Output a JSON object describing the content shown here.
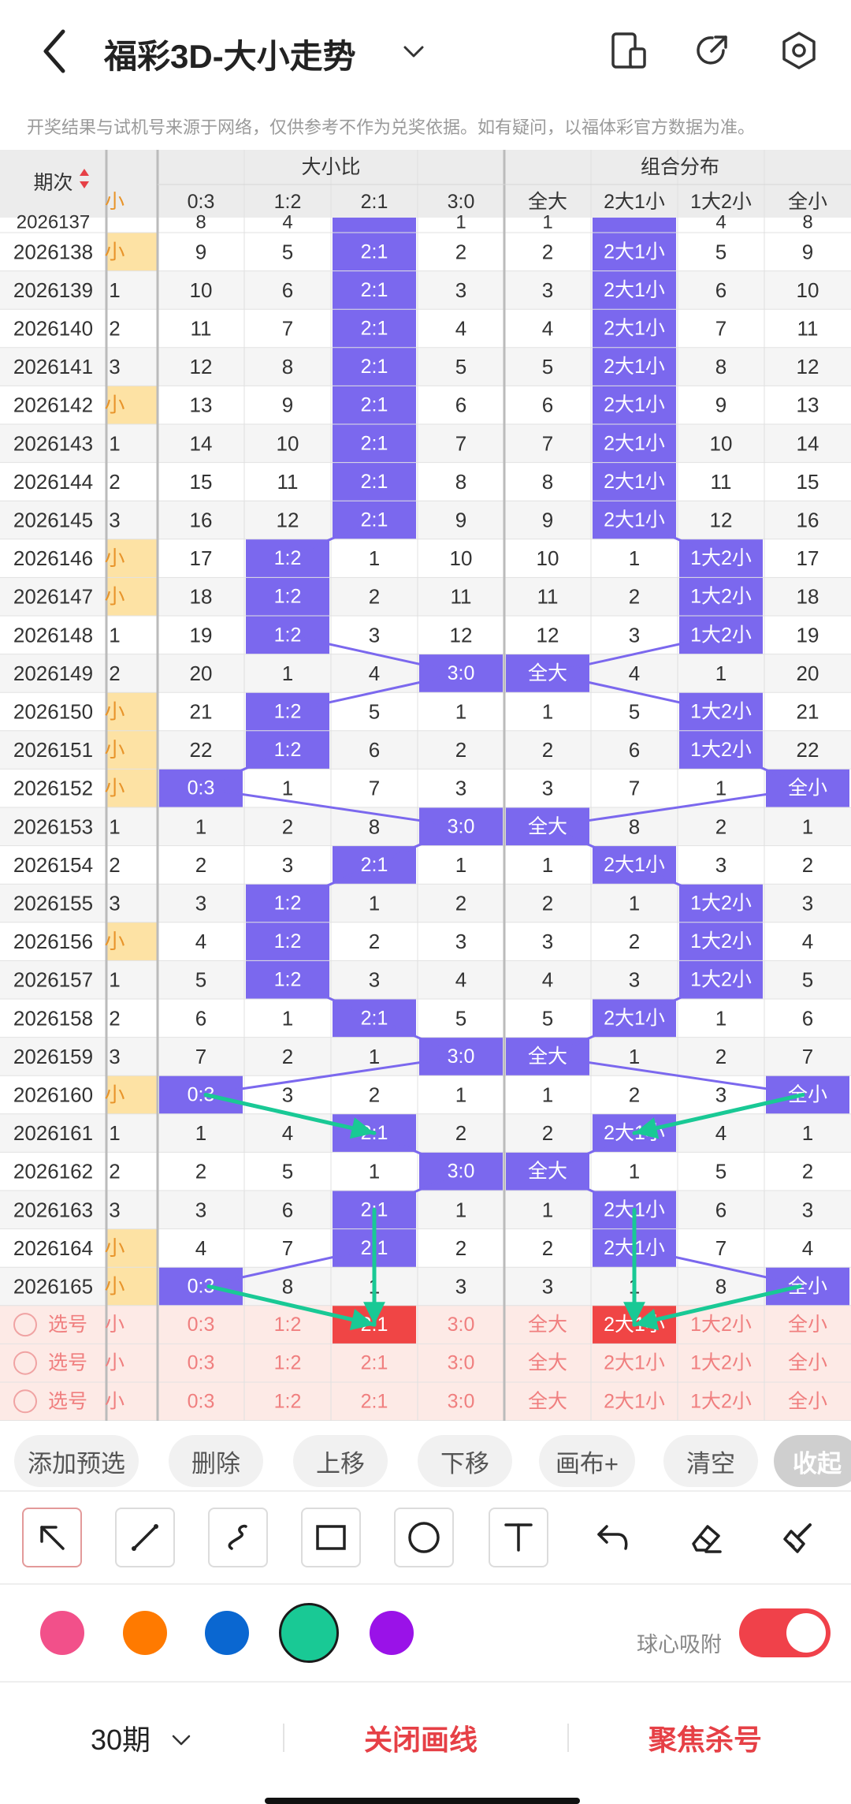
{
  "header": {
    "title": "福彩3D-大小走势",
    "notice": "开奖结果与试机号来源于网络，仅供参考不作为兑奖依据。如有疑问，以福体彩官方数据为准。"
  },
  "table": {
    "period_header": "期次",
    "small_col_header": "小",
    "group_ratio_label": "大小比",
    "group_combo_label": "组合分布",
    "ratio_columns": [
      "0:3",
      "1:2",
      "2:1",
      "3:0"
    ],
    "combo_columns": [
      "全大",
      "2大1小",
      "1大2小",
      "全小"
    ],
    "partial_top_row": {
      "period": "2026137",
      "small": "",
      "ratio": [
        "8",
        "4",
        "",
        "1"
      ],
      "combo": [
        "1",
        "",
        "4",
        "8"
      ]
    },
    "rows": [
      {
        "period": "2026138",
        "small": "小",
        "ratio": [
          "9",
          "5",
          "2:1",
          "2"
        ],
        "combo": [
          "2",
          "2大1小",
          "5",
          "9"
        ]
      },
      {
        "period": "2026139",
        "small": "1",
        "ratio": [
          "10",
          "6",
          "2:1",
          "3"
        ],
        "combo": [
          "3",
          "2大1小",
          "6",
          "10"
        ]
      },
      {
        "period": "2026140",
        "small": "2",
        "ratio": [
          "11",
          "7",
          "2:1",
          "4"
        ],
        "combo": [
          "4",
          "2大1小",
          "7",
          "11"
        ]
      },
      {
        "period": "2026141",
        "small": "3",
        "ratio": [
          "12",
          "8",
          "2:1",
          "5"
        ],
        "combo": [
          "5",
          "2大1小",
          "8",
          "12"
        ]
      },
      {
        "period": "2026142",
        "small": "小",
        "ratio": [
          "13",
          "9",
          "2:1",
          "6"
        ],
        "combo": [
          "6",
          "2大1小",
          "9",
          "13"
        ]
      },
      {
        "period": "2026143",
        "small": "1",
        "ratio": [
          "14",
          "10",
          "2:1",
          "7"
        ],
        "combo": [
          "7",
          "2大1小",
          "10",
          "14"
        ]
      },
      {
        "period": "2026144",
        "small": "2",
        "ratio": [
          "15",
          "11",
          "2:1",
          "8"
        ],
        "combo": [
          "8",
          "2大1小",
          "11",
          "15"
        ]
      },
      {
        "period": "2026145",
        "small": "3",
        "ratio": [
          "16",
          "12",
          "2:1",
          "9"
        ],
        "combo": [
          "9",
          "2大1小",
          "12",
          "16"
        ]
      },
      {
        "period": "2026146",
        "small": "小",
        "ratio": [
          "17",
          "1:2",
          "1",
          "10"
        ],
        "combo": [
          "10",
          "1",
          "1大2小",
          "17"
        ]
      },
      {
        "period": "2026147",
        "small": "小",
        "ratio": [
          "18",
          "1:2",
          "2",
          "11"
        ],
        "combo": [
          "11",
          "2",
          "1大2小",
          "18"
        ]
      },
      {
        "period": "2026148",
        "small": "1",
        "ratio": [
          "19",
          "1:2",
          "3",
          "12"
        ],
        "combo": [
          "12",
          "3",
          "1大2小",
          "19"
        ]
      },
      {
        "period": "2026149",
        "small": "2",
        "ratio": [
          "20",
          "1",
          "4",
          "3:0"
        ],
        "combo": [
          "全大",
          "4",
          "1",
          "20"
        ]
      },
      {
        "period": "2026150",
        "small": "小",
        "ratio": [
          "21",
          "1:2",
          "5",
          "1"
        ],
        "combo": [
          "1",
          "5",
          "1大2小",
          "21"
        ]
      },
      {
        "period": "2026151",
        "small": "小",
        "ratio": [
          "22",
          "1:2",
          "6",
          "2"
        ],
        "combo": [
          "2",
          "6",
          "1大2小",
          "22"
        ]
      },
      {
        "period": "2026152",
        "small": "小",
        "ratio": [
          "0:3",
          "1",
          "7",
          "3"
        ],
        "combo": [
          "3",
          "7",
          "1",
          "全小"
        ]
      },
      {
        "period": "2026153",
        "small": "1",
        "ratio": [
          "1",
          "2",
          "8",
          "3:0"
        ],
        "combo": [
          "全大",
          "8",
          "2",
          "1"
        ]
      },
      {
        "period": "2026154",
        "small": "2",
        "ratio": [
          "2",
          "3",
          "2:1",
          "1"
        ],
        "combo": [
          "1",
          "2大1小",
          "3",
          "2"
        ]
      },
      {
        "period": "2026155",
        "small": "3",
        "ratio": [
          "3",
          "1:2",
          "1",
          "2"
        ],
        "combo": [
          "2",
          "1",
          "1大2小",
          "3"
        ]
      },
      {
        "period": "2026156",
        "small": "小",
        "ratio": [
          "4",
          "1:2",
          "2",
          "3"
        ],
        "combo": [
          "3",
          "2",
          "1大2小",
          "4"
        ]
      },
      {
        "period": "2026157",
        "small": "1",
        "ratio": [
          "5",
          "1:2",
          "3",
          "4"
        ],
        "combo": [
          "4",
          "3",
          "1大2小",
          "5"
        ]
      },
      {
        "period": "2026158",
        "small": "2",
        "ratio": [
          "6",
          "1",
          "2:1",
          "5"
        ],
        "combo": [
          "5",
          "2大1小",
          "1",
          "6"
        ]
      },
      {
        "period": "2026159",
        "small": "3",
        "ratio": [
          "7",
          "2",
          "1",
          "3:0"
        ],
        "combo": [
          "全大",
          "1",
          "2",
          "7"
        ]
      },
      {
        "period": "2026160",
        "small": "小",
        "ratio": [
          "0:3",
          "3",
          "2",
          "1"
        ],
        "combo": [
          "1",
          "2",
          "3",
          "全小"
        ]
      },
      {
        "period": "2026161",
        "small": "1",
        "ratio": [
          "1",
          "4",
          "2:1",
          "2"
        ],
        "combo": [
          "2",
          "2大1小",
          "4",
          "1"
        ]
      },
      {
        "period": "2026162",
        "small": "2",
        "ratio": [
          "2",
          "5",
          "1",
          "3:0"
        ],
        "combo": [
          "全大",
          "1",
          "5",
          "2"
        ]
      },
      {
        "period": "2026163",
        "small": "3",
        "ratio": [
          "3",
          "6",
          "2:1",
          "1"
        ],
        "combo": [
          "1",
          "2大1小",
          "6",
          "3"
        ]
      },
      {
        "period": "2026164",
        "small": "小",
        "ratio": [
          "4",
          "7",
          "2:1",
          "2"
        ],
        "combo": [
          "2",
          "2大1小",
          "7",
          "4"
        ]
      },
      {
        "period": "2026165",
        "small": "小",
        "ratio": [
          "0:3",
          "8",
          "1",
          "3"
        ],
        "combo": [
          "3",
          "1",
          "8",
          "全小"
        ]
      }
    ],
    "pick_label": "选号",
    "pick_rows": [
      {
        "small": "小",
        "ratio": [
          "0:3",
          "1:2",
          "2:1",
          "3:0"
        ],
        "combo": [
          "全大",
          "2大1小",
          "1大2小",
          "全小"
        ]
      },
      {
        "small": "小",
        "ratio": [
          "0:3",
          "1:2",
          "2:1",
          "3:0"
        ],
        "combo": [
          "全大",
          "2大1小",
          "1大2小",
          "全小"
        ]
      },
      {
        "small": "小",
        "ratio": [
          "0:3",
          "1:2",
          "2:1",
          "3:0"
        ],
        "combo": [
          "全大",
          "2大1小",
          "1大2小",
          "全小"
        ]
      }
    ]
  },
  "controls": {
    "add_preselect": "添加预选",
    "delete": "删除",
    "move_up": "上移",
    "move_down": "下移",
    "canvas_plus": "画布+",
    "clear": "清空",
    "collapse": "收起"
  },
  "drawing_tools": [
    "arrow-tool-icon",
    "line-tool-icon",
    "curve-tool-icon",
    "rectangle-tool-icon",
    "circle-tool-icon",
    "text-tool-icon",
    "undo-icon",
    "eraser-icon",
    "brush-clear-icon"
  ],
  "colors": {
    "palette": [
      "#f2508a",
      "#ff7a00",
      "#0a67d1",
      "#19c995",
      "#9a12e8"
    ],
    "selected_color": "#19c995",
    "highlight": "#7b68ee",
    "red_pick": "#f04545",
    "small_col": "#fde2a4",
    "pick_bg": "#fdeae6"
  },
  "snap": {
    "label": "球心吸附",
    "enabled": true
  },
  "bottom": {
    "periods": "30期",
    "close_lines": "关闭画线",
    "focus_kill": "聚焦杀号"
  }
}
